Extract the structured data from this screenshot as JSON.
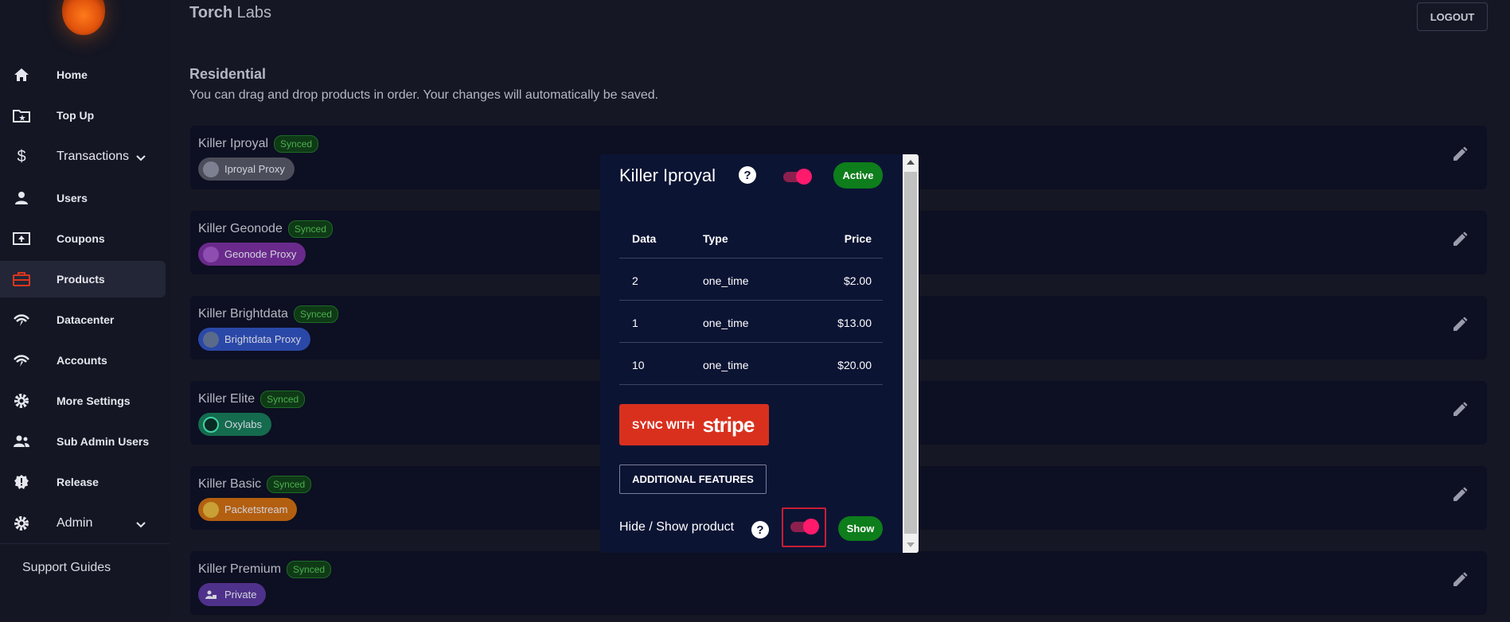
{
  "sidebar": {
    "items": [
      {
        "label": "Home",
        "icon": "home-icon"
      },
      {
        "label": "Top Up",
        "icon": "folder-star-icon"
      },
      {
        "label": "Transactions",
        "icon": "dollar-icon"
      },
      {
        "label": "Users",
        "icon": "user-icon"
      },
      {
        "label": "Coupons",
        "icon": "coupon-icon"
      },
      {
        "label": "Products",
        "icon": "briefcase-icon"
      },
      {
        "label": "Datacenter",
        "icon": "signal-icon"
      },
      {
        "label": "Accounts",
        "icon": "signal-icon"
      },
      {
        "label": "More Settings",
        "icon": "gear-icon"
      },
      {
        "label": "Sub Admin Users",
        "icon": "group-icon"
      },
      {
        "label": "Release",
        "icon": "badge-icon"
      },
      {
        "label": "Admin",
        "icon": "gear-icon"
      }
    ],
    "support": "Support Guides",
    "active_color": "#d9361e"
  },
  "header": {
    "brand_bold": "Torch",
    "brand_rest": " Labs",
    "logout": "LOGOUT"
  },
  "section": {
    "title": "Residential",
    "subtitle": "You can drag and drop products in order. Your changes will automatically be saved."
  },
  "products": [
    {
      "name": "Killer Iproyal",
      "status": "Synced",
      "tag": "Iproyal Proxy",
      "tag_color": "#4b4d5a"
    },
    {
      "name": "Killer Geonode",
      "status": "Synced",
      "tag": "Geonode Proxy",
      "tag_color": "#6a2a8c"
    },
    {
      "name": "Killer Brightdata",
      "status": "Synced",
      "tag": "Brightdata Proxy",
      "tag_color": "#2a48a8"
    },
    {
      "name": "Killer Elite",
      "status": "Synced",
      "tag": "Oxylabs",
      "tag_color": "#146b4e"
    },
    {
      "name": "Killer Basic",
      "status": "Synced",
      "tag": "Packetstream",
      "tag_color": "#b35f10"
    },
    {
      "name": "Killer Premium",
      "status": "Synced",
      "tag": "Private",
      "tag_color": "#4e318a"
    }
  ],
  "modal": {
    "title": "Killer Iproyal",
    "status": "Active",
    "table": {
      "headers": [
        "Data",
        "Type",
        "Price"
      ],
      "rows": [
        [
          "2",
          "one_time",
          "$2.00"
        ],
        [
          "1",
          "one_time",
          "$13.00"
        ],
        [
          "10",
          "one_time",
          "$20.00"
        ]
      ]
    },
    "sync_prefix": "SYNC WITH",
    "sync_brand": "stripe",
    "features": "ADDITIONAL FEATURES",
    "hide_show_label": "Hide / Show product",
    "show_label": "Show"
  }
}
